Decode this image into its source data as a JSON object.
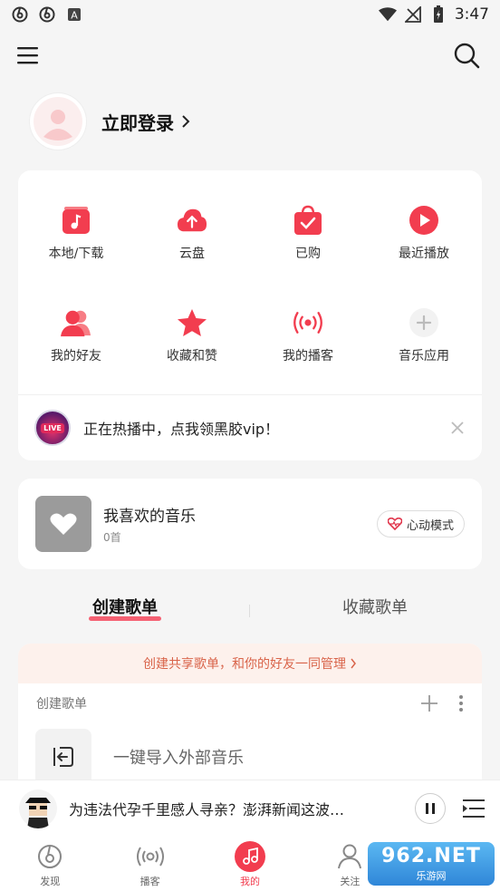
{
  "status_bar": {
    "time": "3:47"
  },
  "profile": {
    "login_label": "立即登录"
  },
  "quick_grid": [
    {
      "label": "本地/下载",
      "icon": "music-download-icon"
    },
    {
      "label": "云盘",
      "icon": "cloud-upload-icon"
    },
    {
      "label": "已购",
      "icon": "shopping-bag-icon"
    },
    {
      "label": "最近播放",
      "icon": "play-circle-icon"
    },
    {
      "label": "我的好友",
      "icon": "friends-icon"
    },
    {
      "label": "收藏和赞",
      "icon": "star-icon"
    },
    {
      "label": "我的播客",
      "icon": "broadcast-icon"
    },
    {
      "label": "音乐应用",
      "icon": "add-app-icon"
    }
  ],
  "promo": {
    "badge": "LIVE",
    "text": "正在热播中，点我领黑胶vip！"
  },
  "favorite": {
    "title": "我喜欢的音乐",
    "count": "0首",
    "mode_label": "心动模式"
  },
  "tabs": {
    "created": "创建歌单",
    "collected": "收藏歌单"
  },
  "playlist_section": {
    "share_banner": "创建共享歌单，和你的好友一同管理",
    "header": "创建歌单",
    "import_label": "一键导入外部音乐"
  },
  "player": {
    "song": "为违法代孕千里感人寻亲？澎湃新闻这波…"
  },
  "bottom_nav": [
    {
      "label": "发现"
    },
    {
      "label": "播客"
    },
    {
      "label": "我的"
    },
    {
      "label": "关注"
    },
    {
      "label": ""
    }
  ],
  "watermark": {
    "main": "962.NET",
    "sub": "乐游网"
  },
  "colors": {
    "accent": "#f23d4f",
    "background": "#f5f5f5"
  }
}
